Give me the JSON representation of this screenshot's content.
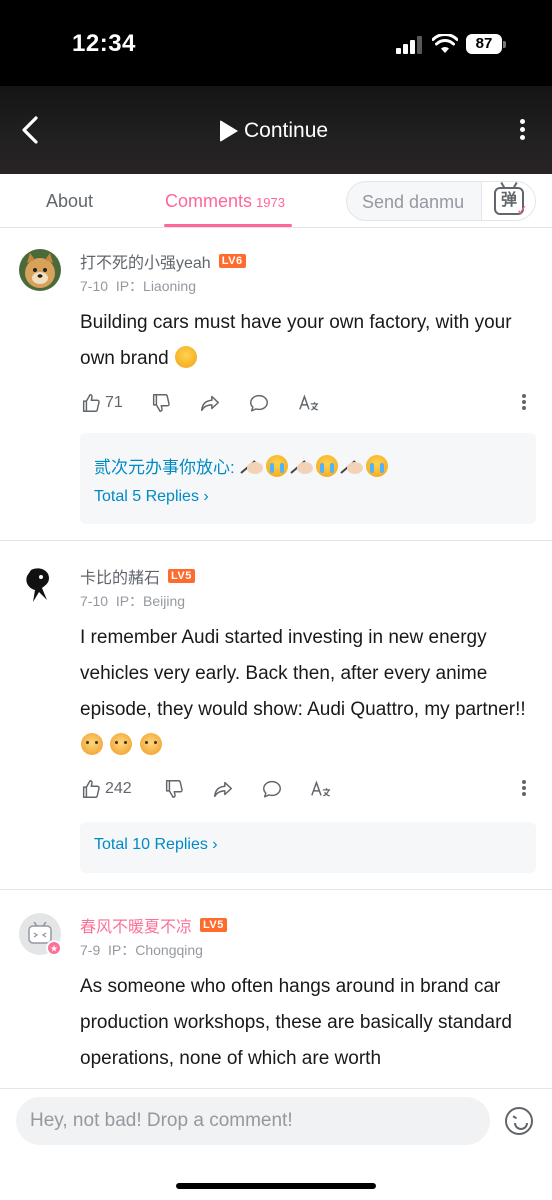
{
  "status_bar": {
    "time": "12:34",
    "battery": "87"
  },
  "video_header": {
    "continue_label": "Continue"
  },
  "tabs": {
    "about": "About",
    "comments": "Comments",
    "comments_count": "1973",
    "danmu_placeholder": "Send danmu",
    "danmu_icon_glyph": "弹"
  },
  "comments": [
    {
      "username": "打不死的小强yeah",
      "level": "LV6",
      "date": "7-10",
      "ip": "IP：Liaoning",
      "content": "Building cars must have your own factory, with your own brand",
      "likes": "71",
      "reply_preview": {
        "name": "贰次元办事你放心:"
      },
      "total_replies": "Total 5 Replies"
    },
    {
      "username": "卡比的赭石",
      "level": "LV5",
      "date": "7-10",
      "ip": "IP：Beijing",
      "content": "I remember Audi started investing in new energy vehicles very early. Back then, after every anime episode, they would show: Audi Quattro, my partner!!",
      "likes": "242",
      "total_replies": "Total 10 Replies"
    },
    {
      "username": "春风不暖夏不凉",
      "level": "LV5",
      "date": "7-9",
      "ip": "IP：Chongqing",
      "content": "As someone who often hangs around in brand car production workshops, these are basically standard operations, none of which are worth"
    }
  ],
  "bottom_bar": {
    "placeholder": "Hey, not bad! Drop a comment!"
  },
  "colors": {
    "accent": "#ff6699",
    "link": "#008ac5",
    "level_badge": "#ff6b2c"
  }
}
